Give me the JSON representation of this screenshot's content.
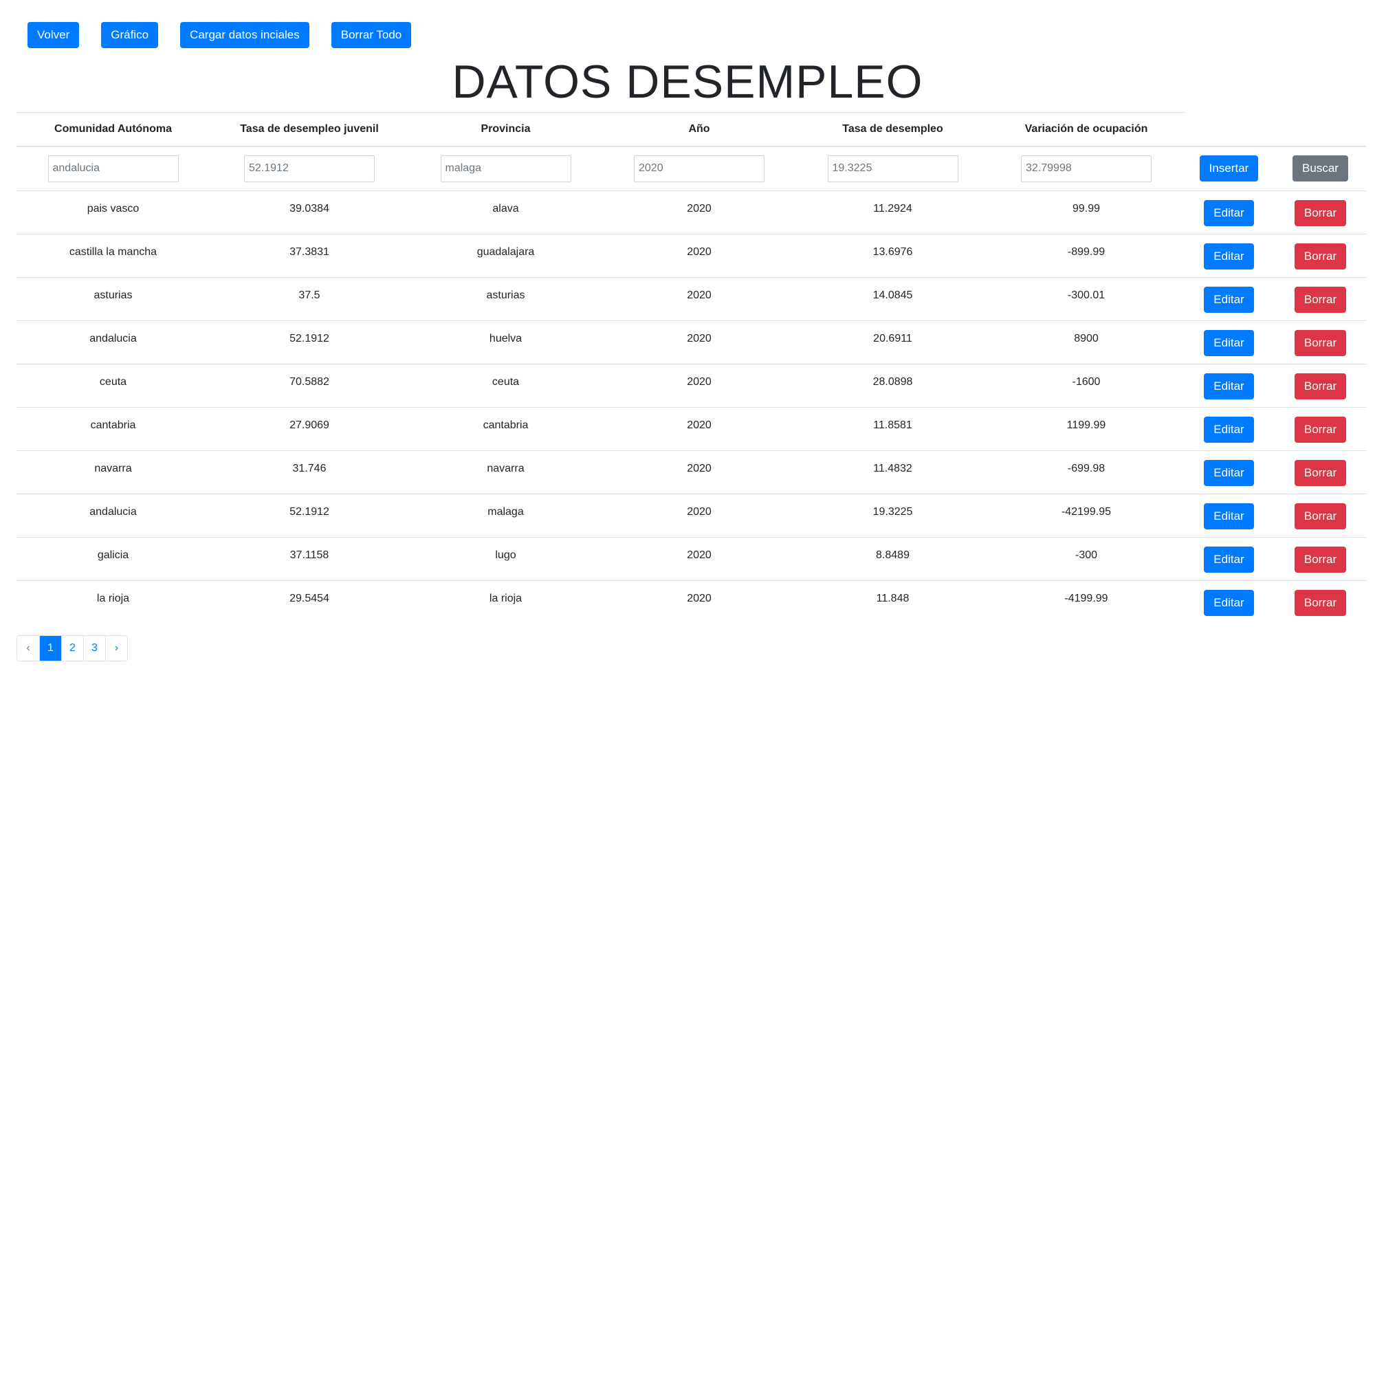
{
  "toolbar": {
    "volver": "Volver",
    "grafico": "Gráfico",
    "cargar": "Cargar datos inciales",
    "borrar_todo": "Borrar Todo"
  },
  "title": "DATOS DESEMPLEO",
  "table": {
    "headers": [
      "Comunidad Autónoma",
      "Tasa de desempleo juvenil",
      "Provincia",
      "Año",
      "Tasa de desempleo",
      "Variación de ocupación"
    ],
    "inputs": {
      "comunidad": "andalucia",
      "tasa_juvenil": "52.1912",
      "provincia": "malaga",
      "anio": "2020",
      "tasa": "19.3225",
      "variacion": "32.79998"
    },
    "insert_label": "Insertar",
    "search_label": "Buscar",
    "edit_label": "Editar",
    "delete_label": "Borrar",
    "rows": [
      [
        "pais vasco",
        "39.0384",
        "alava",
        "2020",
        "11.2924",
        "99.99"
      ],
      [
        "castilla la mancha",
        "37.3831",
        "guadalajara",
        "2020",
        "13.6976",
        "-899.99"
      ],
      [
        "asturias",
        "37.5",
        "asturias",
        "2020",
        "14.0845",
        "-300.01"
      ],
      [
        "andalucia",
        "52.1912",
        "huelva",
        "2020",
        "20.6911",
        "8900"
      ],
      [
        "ceuta",
        "70.5882",
        "ceuta",
        "2020",
        "28.0898",
        "-1600"
      ],
      [
        "cantabria",
        "27.9069",
        "cantabria",
        "2020",
        "11.8581",
        "1199.99"
      ],
      [
        "navarra",
        "31.746",
        "navarra",
        "2020",
        "11.4832",
        "-699.98"
      ],
      [
        "andalucia",
        "52.1912",
        "malaga",
        "2020",
        "19.3225",
        "-42199.95"
      ],
      [
        "galicia",
        "37.1158",
        "lugo",
        "2020",
        "8.8489",
        "-300"
      ],
      [
        "la rioja",
        "29.5454",
        "la rioja",
        "2020",
        "11.848",
        "-4199.99"
      ]
    ]
  },
  "pagination": {
    "prev": "‹",
    "pages": [
      "1",
      "2",
      "3"
    ],
    "active": "1",
    "next": "›"
  },
  "colors": {
    "primary": "#007bff",
    "secondary": "#6c757d",
    "danger": "#dc3545"
  }
}
